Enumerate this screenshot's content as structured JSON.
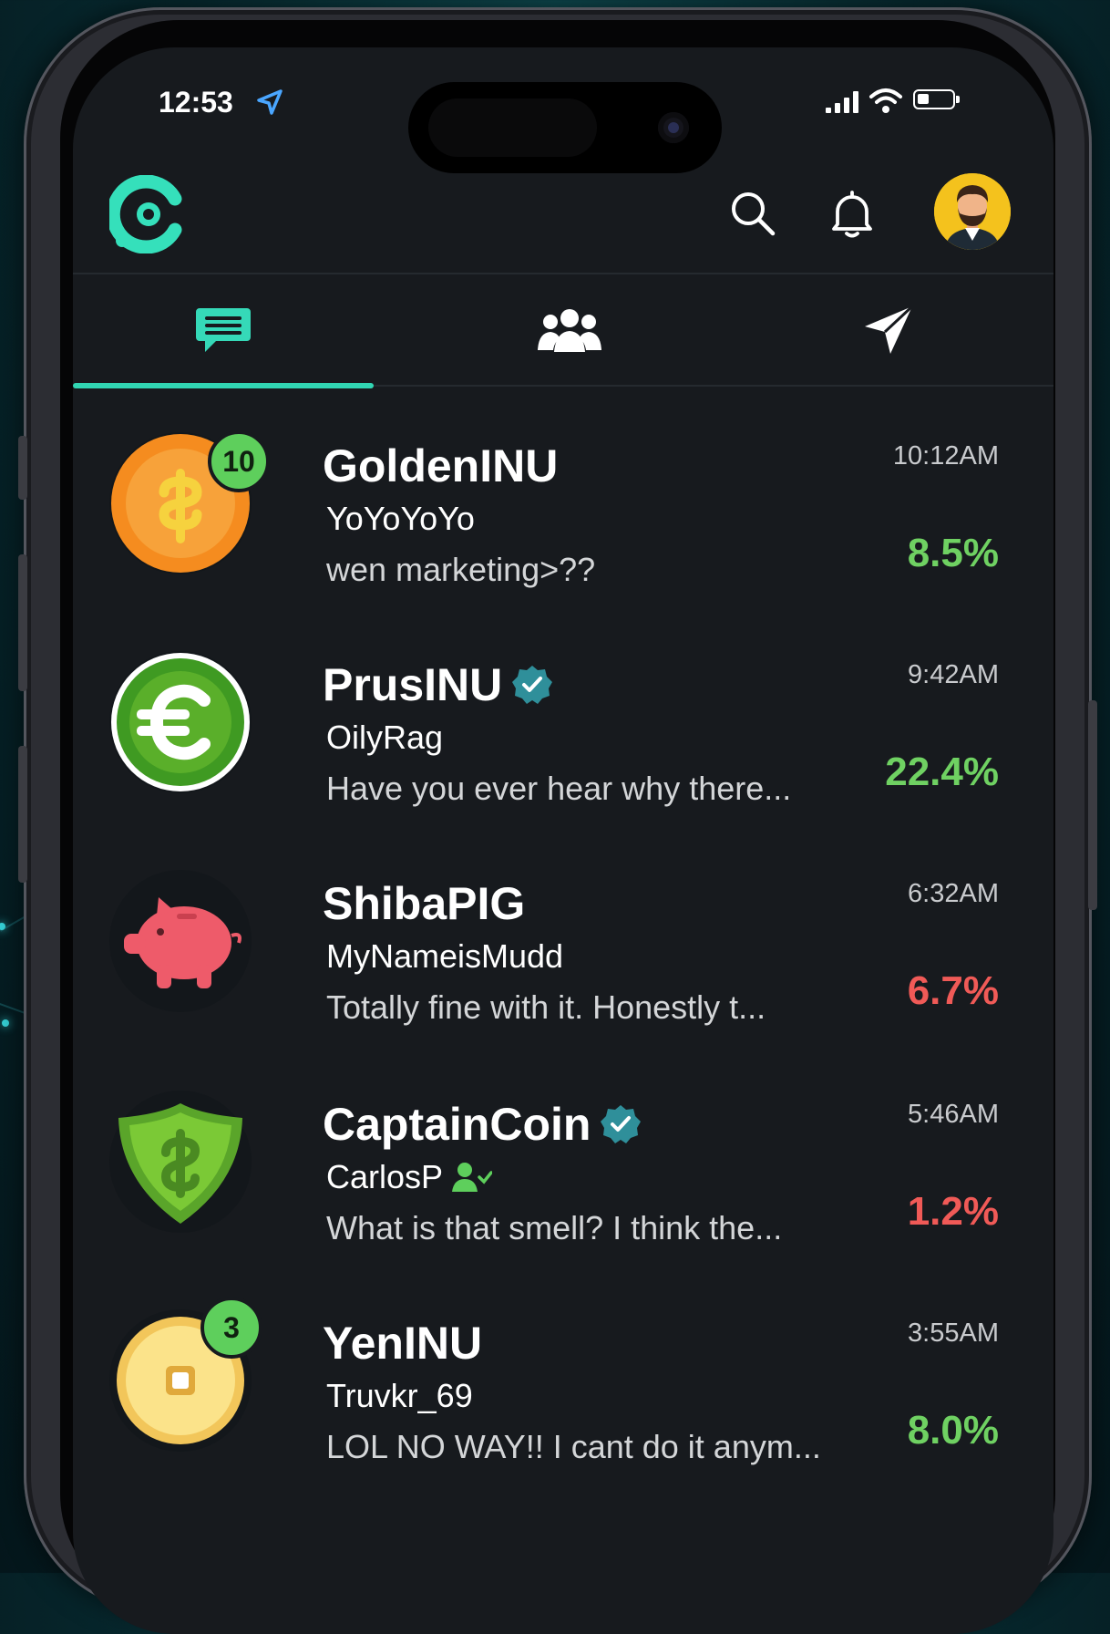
{
  "status_bar": {
    "time": "12:53"
  },
  "header": {
    "logo_icon": "app-logo-icon",
    "search_icon": "search-icon",
    "notifications_icon": "bell-icon",
    "avatar_icon": "user-avatar"
  },
  "tabs": [
    {
      "icon": "chat-bubble-icon",
      "active": true
    },
    {
      "icon": "group-icon",
      "active": false
    },
    {
      "icon": "send-icon",
      "active": false
    }
  ],
  "colors": {
    "accent": "#31d6b3",
    "positive": "#6fd162",
    "negative": "#f05a57",
    "badge": "#5ecf5c",
    "verified": "#2f8f9a"
  },
  "chats": [
    {
      "name": "GoldenINU",
      "user": "YoYoYoYo",
      "message": "wen marketing>??",
      "time": "10:12AM",
      "percent": "8.5%",
      "trend": "up",
      "unread": "10",
      "verified": false,
      "user_badge": false,
      "icon": "dollar-coin-icon"
    },
    {
      "name": "PrusINU",
      "user": "OilyRag",
      "message": "Have you ever hear why there...",
      "time": "9:42AM",
      "percent": "22.4%",
      "trend": "up",
      "unread": "",
      "verified": true,
      "user_badge": false,
      "icon": "euro-coin-icon"
    },
    {
      "name": "ShibaPIG",
      "user": "MyNameisMudd",
      "message": "Totally fine with it. Honestly t...",
      "time": "6:32AM",
      "percent": "6.7%",
      "trend": "down",
      "unread": "",
      "verified": false,
      "user_badge": false,
      "icon": "piggy-bank-icon"
    },
    {
      "name": "CaptainCoin",
      "user": "CarlosP",
      "message": "What is that smell? I think the...",
      "time": "5:46AM",
      "percent": "1.2%",
      "trend": "down",
      "unread": "",
      "verified": true,
      "user_badge": true,
      "icon": "dollar-shield-icon"
    },
    {
      "name": "YenINU",
      "user": "Truvkr_69",
      "message": "LOL NO WAY!! I cant do it anym...",
      "time": "3:55AM",
      "percent": "8.0%",
      "trend": "up",
      "unread": "3",
      "verified": false,
      "user_badge": false,
      "icon": "yen-coin-icon"
    }
  ]
}
